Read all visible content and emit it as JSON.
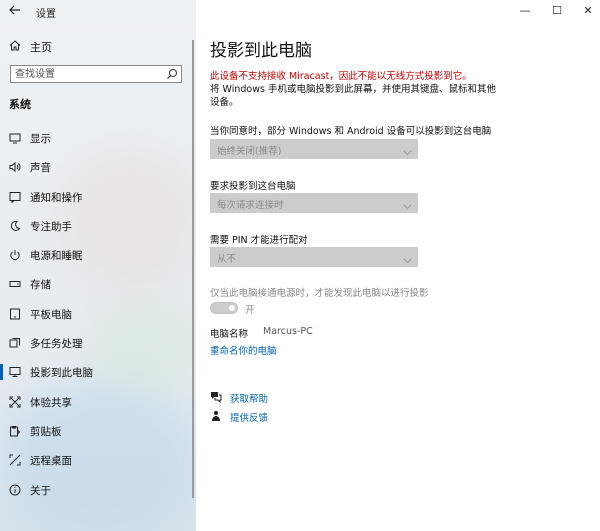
{
  "window": {
    "title": "设置",
    "minimize": "—",
    "maximize": "☐",
    "close": "✕"
  },
  "sidebar": {
    "home": "主页",
    "search_placeholder": "查找设置",
    "section": "系统",
    "items": [
      {
        "label": "显示",
        "icon": "monitor-icon"
      },
      {
        "label": "声音",
        "icon": "speaker-icon"
      },
      {
        "label": "通知和操作",
        "icon": "notification-icon"
      },
      {
        "label": "专注助手",
        "icon": "moon-icon"
      },
      {
        "label": "电源和睡眠",
        "icon": "power-icon"
      },
      {
        "label": "存储",
        "icon": "storage-icon"
      },
      {
        "label": "平板电脑",
        "icon": "tablet-icon"
      },
      {
        "label": "多任务处理",
        "icon": "multitasking-icon"
      },
      {
        "label": "投影到此电脑",
        "icon": "projecting-icon",
        "selected": true
      },
      {
        "label": "体验共享",
        "icon": "shared-experiences-icon"
      },
      {
        "label": "剪贴板",
        "icon": "clipboard-icon"
      },
      {
        "label": "远程桌面",
        "icon": "remote-desktop-icon"
      },
      {
        "label": "关于",
        "icon": "info-icon"
      }
    ]
  },
  "main": {
    "title": "投影到此电脑",
    "warning": "此设备不支持接收 Miracast，因此不能以无线方式投影到它。",
    "description": "将 Windows 手机或电脑投影到此屏幕，并使用其键盘、鼠标和其他设备。",
    "setting1_label": "当你同意时，部分 Windows 和 Android 设备可以投影到这台电脑",
    "setting1_value": "始终关闭(推荐)",
    "setting2_label": "要求投影到这台电脑",
    "setting2_value": "每次请求连接时",
    "setting3_label": "需要 PIN 才能进行配对",
    "setting3_value": "从不",
    "setting4_label": "仅当此电脑接通电源时，才能发现此电脑以进行投影",
    "toggle_label": "开",
    "pc_name_label": "电脑名称",
    "pc_name_value": "Marcus-PC",
    "rename_link": "重命名你的电脑",
    "help_link": "获取帮助",
    "feedback_link": "提供反馈"
  },
  "colors": {
    "accent": "#0063b1",
    "warning": "#c50000",
    "disabled": "#8a8a8a"
  }
}
